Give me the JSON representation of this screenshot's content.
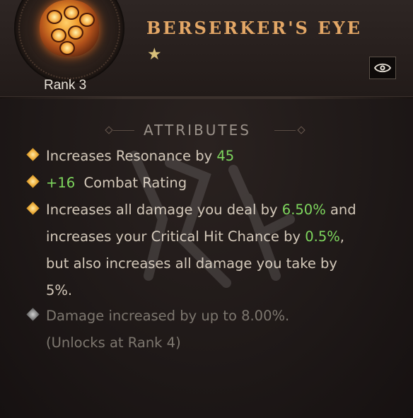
{
  "item": {
    "name": "BERSERKER'S EYE",
    "rank": "Rank 3",
    "stars": "★",
    "icon": "berserkers-eye-gem-icon",
    "toggle_icon": "eye-icon"
  },
  "attributes": {
    "heading": "ATTRIBUTES",
    "lines": [
      {
        "pre": "Increases Resonance by ",
        "value": "45",
        "post": ""
      },
      {
        "pre": "",
        "value": "+16",
        "post": "  Combat Rating"
      },
      {
        "part1": "Increases all damage you deal by ",
        "value1": "6.50%",
        "part2": " and increases your Critical Hit Chance by ",
        "value2": "0.5%",
        "part3": ", but also increases all damage you take by 5%."
      },
      {
        "text": "Damage increased by up to 8.00%.",
        "note": "(Unlocks at Rank 4)"
      }
    ]
  },
  "colors": {
    "title": "#e3a766",
    "highlight": "#7ed75e",
    "text": "#d4c9ba",
    "locked": "#7d776f"
  }
}
